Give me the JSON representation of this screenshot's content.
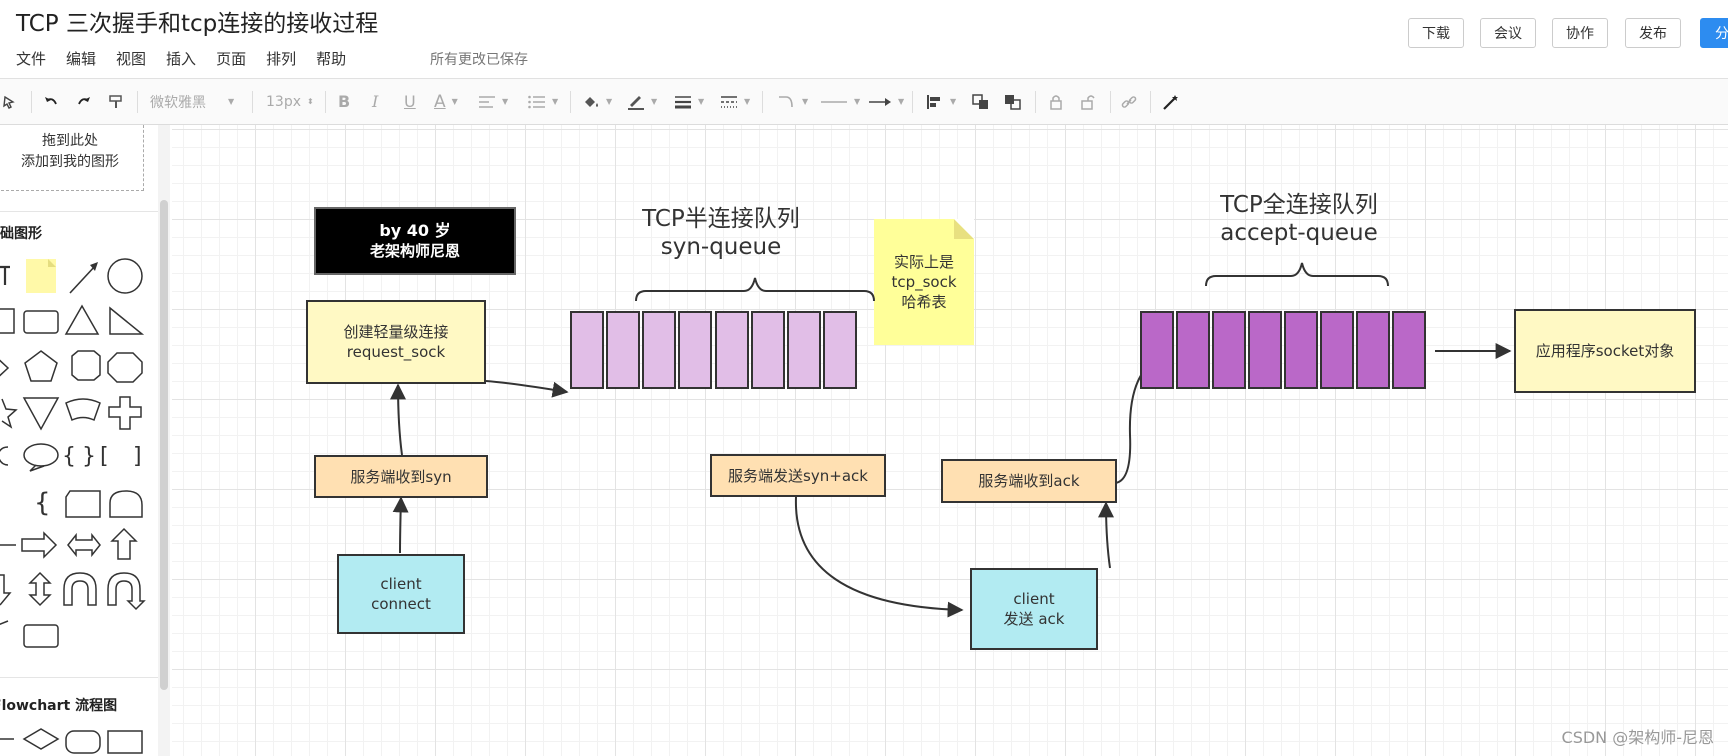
{
  "title": "TCP 三次握手和tcp连接的接收过程",
  "menu": [
    "文件",
    "编辑",
    "视图",
    "插入",
    "页面",
    "排列",
    "帮助"
  ],
  "save_status": "所有更改已保存",
  "header_buttons": {
    "download": "下载",
    "meeting": "会议",
    "collab": "协作",
    "publish": "发布",
    "share": "分享"
  },
  "toolbar": {
    "font_family": "微软雅黑",
    "font_size": "13px",
    "bold": "B",
    "italic": "I",
    "underline": "U",
    "font_color": "A"
  },
  "sidebar": {
    "drop_hint_line1": "拖到此处",
    "drop_hint_line2": "添加到我的图形",
    "section_basic": "基础图形",
    "section_flowchart": "Flowchart 流程图"
  },
  "diagram": {
    "author_line1": "by 40 岁",
    "author_line2": "老架构师尼恩",
    "syn_queue_title_1": "TCP半连接队列",
    "syn_queue_title_2": "syn-queue",
    "accept_queue_title_1": "TCP全连接队列",
    "accept_queue_title_2": "accept-queue",
    "note_line1": "实际上是",
    "note_line2": "tcp_sock",
    "note_line3": "哈希表",
    "request_sock_line1": "创建轻量级连接",
    "request_sock_line2": "request_sock",
    "server_recv_syn": "服务端收到syn",
    "client_connect_line1": "client",
    "client_connect_line2": "connect",
    "server_send_synack": "服务端发送syn+ack",
    "server_recv_ack": "服务端收到ack",
    "client_ack_line1": "client",
    "client_ack_line2": "发送 ack",
    "app_socket": "应用程序socket对象",
    "syn_queue_cells": 8,
    "accept_queue_cells": 8
  },
  "colors": {
    "syn_cell": "#e1bee7",
    "accept_cell": "#ba68c8",
    "yellow_box": "#fff9c4",
    "orange_box": "#ffe0b2",
    "cyan_box": "#b2ebf2",
    "note": "#ffff99",
    "accent": "#2d8cf0"
  },
  "watermark": "CSDN @架构师-尼恩"
}
